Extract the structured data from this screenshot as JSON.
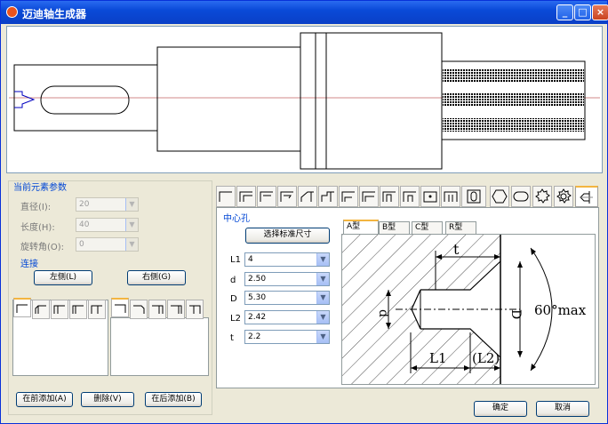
{
  "window": {
    "title": "迈迪轴生成器",
    "min": "_",
    "max": "□",
    "close": "×"
  },
  "current_params": {
    "section_title": "当前元素参数",
    "diameter_label": "直径(I):",
    "diameter_value": "20",
    "length_label": "长度(H):",
    "length_value": "40",
    "angle_label": "旋转角(O):",
    "angle_value": "0"
  },
  "connect": {
    "section_title": "连接",
    "left_label": "左侧(L)",
    "right_label": "右侧(G)"
  },
  "actions": {
    "add_before": "在前添加(A)",
    "delete": "删除(V)",
    "add_after": "在后添加(B)"
  },
  "center_hole": {
    "section_title": "中心孔",
    "select_std": "选择标准尺寸",
    "fields": [
      {
        "label": "L1",
        "value": "4"
      },
      {
        "label": "d",
        "value": "2.50"
      },
      {
        "label": "D",
        "value": "5.30"
      },
      {
        "label": "L2",
        "value": "2.42"
      },
      {
        "label": "t",
        "value": "2.2"
      }
    ],
    "tabs": [
      "A型",
      "B型",
      "C型",
      "R型"
    ],
    "diagram": {
      "t": "t",
      "d": "d",
      "D": "D",
      "angle": "60°max",
      "l1": "L1",
      "l2": "(L2)"
    }
  },
  "footer": {
    "ok": "确定",
    "cancel": "取消"
  }
}
